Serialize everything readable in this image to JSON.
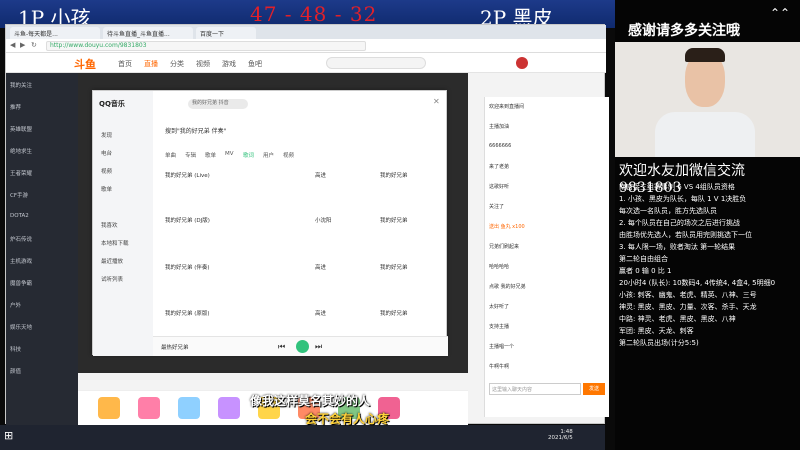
{
  "overlay": {
    "p1": "1P 小孩",
    "score": "47 - 48 - 32",
    "p2": "2P 黑皮"
  },
  "browser": {
    "tabs": [
      "斗鱼-每天都是...",
      "待斗鱼直播_斗鱼直播...",
      "百度一下"
    ],
    "url": "http://www.douyu.com/9831803",
    "logo": "斗鱼",
    "nav": [
      "首页",
      "直播",
      "分类",
      "视频",
      "游戏",
      "鱼吧"
    ]
  },
  "left_sidebar": {
    "items": [
      "我的关注",
      "推荐",
      "英雄联盟",
      "绝地求生",
      "王者荣耀",
      "CF手游",
      "DOTA2",
      "炉石传说",
      "主机游戏",
      "魔兽争霸",
      "户外",
      "娱乐天地",
      "科技",
      "颜值"
    ]
  },
  "qq_music": {
    "logo": "QQ音乐",
    "search_query": "我的好兄弟 抖音",
    "side_items": [
      "发现",
      "电台",
      "视频",
      "歌单",
      "我喜欢",
      "本地和下载",
      "最近播放",
      "试听列表"
    ],
    "hint": "搜到\"我的好兄弟 伴奏\"",
    "tabs": [
      "单曲",
      "专辑",
      "歌单",
      "MV",
      "歌词",
      "用户",
      "视频"
    ],
    "songs": [
      {
        "title": "我的好兄弟 (Live)",
        "artist": "高进",
        "album": "我的好兄弟"
      },
      {
        "title": "我的好兄弟 (DJ版)",
        "artist": "小沈阳",
        "album": "我的好兄弟"
      },
      {
        "title": "我的好兄弟 (伴奏)",
        "artist": "高进",
        "album": "我的好兄弟"
      },
      {
        "title": "我的好兄弟 (原版)",
        "artist": "高进",
        "album": "我的好兄弟"
      }
    ],
    "now_playing": "最热好兄弟"
  },
  "chat": {
    "lines": [
      "欢迎来到直播间",
      "主播加油",
      "6666666",
      "来了老弟",
      "这歌好听",
      "关注了",
      "送出 鱼丸 x100",
      "兄弟们刷起来",
      "哈哈哈哈",
      "点歌 我的好兄弟",
      "太好听了",
      "支持主播",
      "主播唱一个",
      "牛啊牛啊"
    ],
    "input_placeholder": "这里输入聊天内容",
    "send_label": "发送"
  },
  "taskbar": {
    "time": "1:48",
    "date": "2021/6/5"
  },
  "subtitles": {
    "line1": "像我这样莫名其妙的人",
    "line2": "会不会有人心疼"
  },
  "right_panel": {
    "banner": "感谢请多多关注哦",
    "title": "欢迎水友加微信交流9831803",
    "rules": [
      "南宫接三组赛事制 6 VS 4组队员资格",
      "1. 小孩、黑皮为队长，每队 1 V 1决胜负",
      "每次选一名队员，胜方先选队员",
      "2. 每个队员在自己的场次之后进行挑战",
      "由胜场优先选人，若队员用完则挑选下一位",
      "3. 每人限一场，败者淘汰 第一轮结果",
      "第二轮自由组合",
      "赢者 0  输 0 比 1",
      "20小时4 (队长): 10数码4, 4传统4, 4盒4, 5明细0",
      "小孩: 刺客、幽鬼、老虎、精英、八神、三号",
      "神灵: 黑皮、黑皮、力量、次客、杀手、天龙",
      "中路: 神灵、老虎、黑皮、黑皮、八神",
      "军团: 黑皮、天龙、刺客",
      "第二轮队员出场(计分5:5)"
    ]
  }
}
